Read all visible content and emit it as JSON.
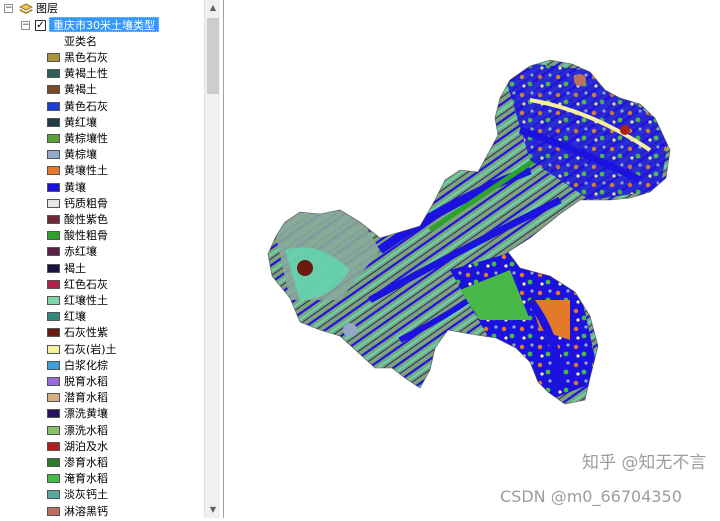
{
  "toc": {
    "root_label": "图层",
    "layer_name": "重庆市30米土壤类型",
    "field_name": "亚类名",
    "legend": [
      {
        "label": "黑色石灰",
        "color": "#a8953a"
      },
      {
        "label": "黄褐土性",
        "color": "#2e5e5a"
      },
      {
        "label": "黄褐土",
        "color": "#7a4a24"
      },
      {
        "label": "黄色石灰",
        "color": "#1a3fd6"
      },
      {
        "label": "黄红壤",
        "color": "#1f3b4a"
      },
      {
        "label": "黄棕壤性",
        "color": "#5aa038"
      },
      {
        "label": "黄棕壤",
        "color": "#94a8c8"
      },
      {
        "label": "黄壤性土",
        "color": "#e27a2a"
      },
      {
        "label": "黄壤",
        "color": "#1c12e0"
      },
      {
        "label": "钙质粗骨",
        "color": "#e6e6e6"
      },
      {
        "label": "酸性紫色",
        "color": "#6e2a36"
      },
      {
        "label": "酸性粗骨",
        "color": "#2ea02e"
      },
      {
        "label": "赤红壤",
        "color": "#5a2048"
      },
      {
        "label": "褐土",
        "color": "#1a1440"
      },
      {
        "label": "红色石灰",
        "color": "#b0204a"
      },
      {
        "label": "红壤性土",
        "color": "#7ed6a8"
      },
      {
        "label": "红壤",
        "color": "#2e8a7a"
      },
      {
        "label": "石灰性紫",
        "color": "#6a1a10"
      },
      {
        "label": "石灰(岩)土",
        "color": "#f6f0a0"
      },
      {
        "label": "白浆化棕",
        "color": "#3aa0d8"
      },
      {
        "label": "脱育水稻",
        "color": "#9a6ad8"
      },
      {
        "label": "潜育水稻",
        "color": "#d8b080"
      },
      {
        "label": "漂洗黄壤",
        "color": "#2a1060"
      },
      {
        "label": "漂洗水稻",
        "color": "#8ac06a"
      },
      {
        "label": "湖泊及水",
        "color": "#b01e1e"
      },
      {
        "label": "渗育水稻",
        "color": "#2a7a2a"
      },
      {
        "label": "淹育水稻",
        "color": "#48b848"
      },
      {
        "label": "淡灰钙土",
        "color": "#58a8a0"
      },
      {
        "label": "淋溶黑钙",
        "color": "#b87060"
      }
    ]
  },
  "map": {
    "watermark_zhihu": "知乎 @知无不言",
    "watermark_csdn": "CSDN @m0_66704350"
  },
  "colors": {
    "selection": "#3399ff",
    "map_land_green": "#7fa37a",
    "map_blue": "#1c12e0"
  }
}
